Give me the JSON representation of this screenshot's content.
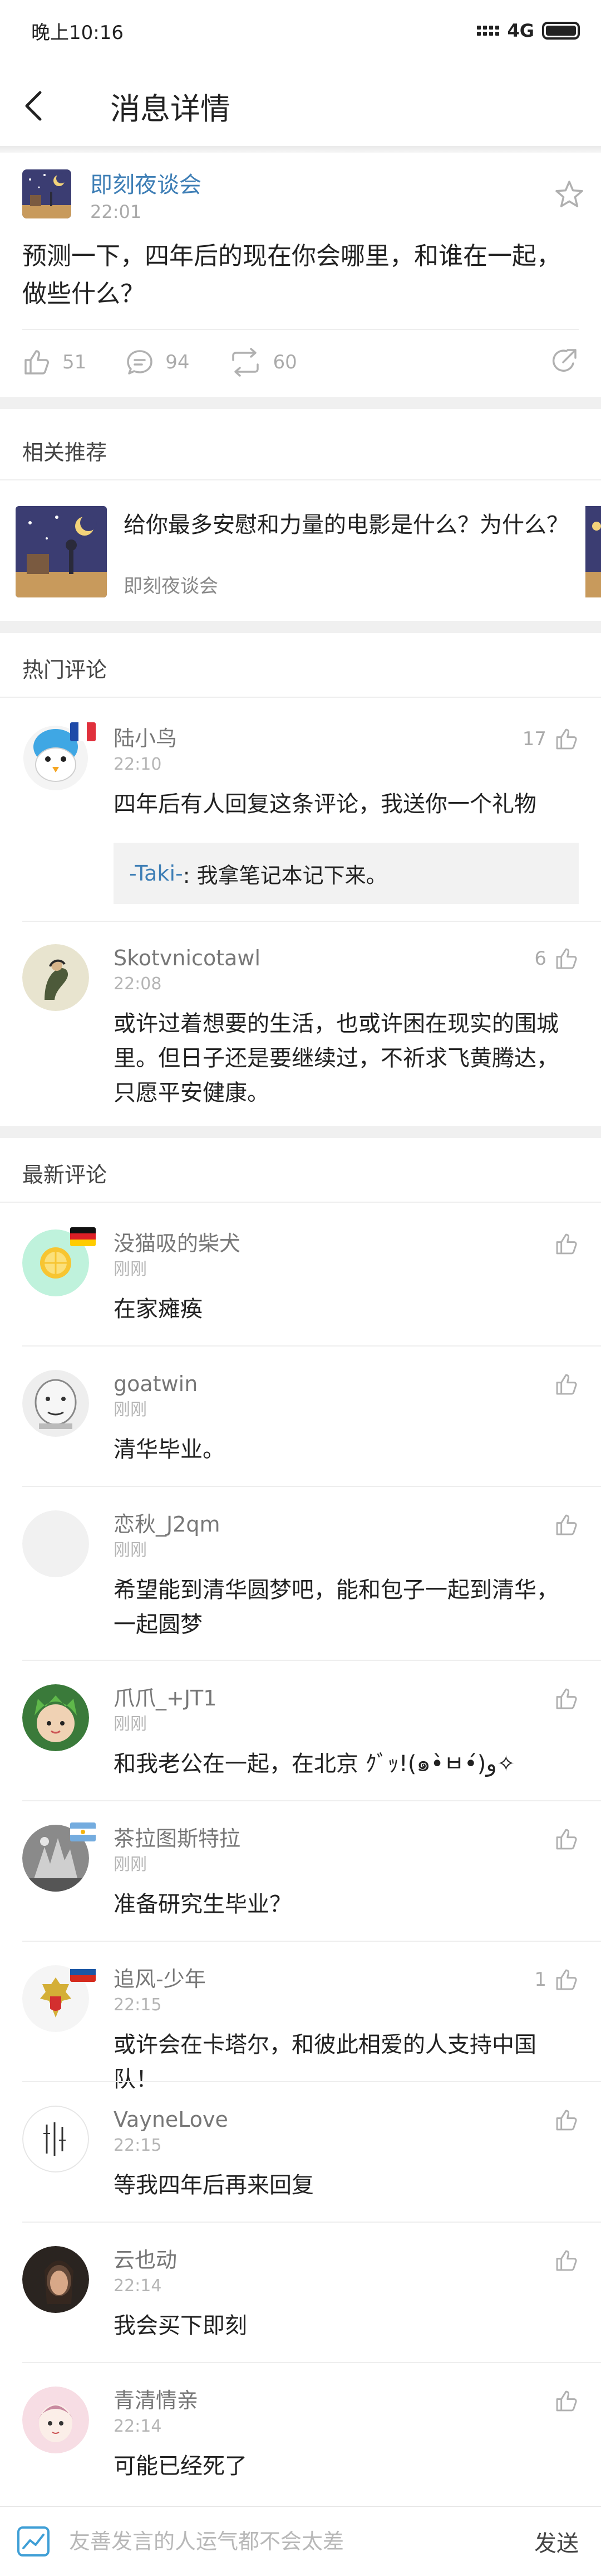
{
  "status_bar": {
    "time": "晚上10:16",
    "network": "4G"
  },
  "header": {
    "title": "消息详情"
  },
  "post": {
    "group_name": "即刻夜谈会",
    "time": "22:01",
    "text": "预测一下，四年后的现在你会哪里，和谁在一起，做些什么？",
    "likes": "51",
    "comments": "94",
    "reposts": "60"
  },
  "related": {
    "heading": "相关推荐",
    "items": [
      {
        "title": "给你最多安慰和力量的电影是什么？为什么？",
        "group": "即刻夜谈会"
      }
    ]
  },
  "hot": {
    "heading": "热门评论",
    "comments": [
      {
        "name": "陆小鸟",
        "time": "22:10",
        "likes": "17",
        "text": "四年后有人回复这条评论，我送你一个礼物",
        "flag": "france",
        "reply_user": "-Taki-",
        "reply_text": ": 我拿笔记本记下来。"
      },
      {
        "name": "Skotvnicotawl",
        "time": "22:08",
        "likes": "6",
        "text": "或许过着想要的生活，也或许困在现实的围城里。但日子还是要继续过，不祈求飞黄腾达，只愿平安健康。"
      }
    ]
  },
  "latest": {
    "heading": "最新评论",
    "comments": [
      {
        "name": "没猫吸的柴犬",
        "time": "刚刚",
        "likes": "",
        "text": "在家瘫痪",
        "flag": "germany"
      },
      {
        "name": "goatwin",
        "time": "刚刚",
        "likes": "",
        "text": "清华毕业。"
      },
      {
        "name": "恋秋_J2qm",
        "time": "刚刚",
        "likes": "",
        "text": "希望能到清华圆梦吧，能和包子一起到清华，一起圆梦"
      },
      {
        "name": "爪爪_+JT1",
        "time": "刚刚",
        "likes": "",
        "text": "和我老公在一起，在北京 ｸﾞｯ!(๑•̀ㅂ•́)و✧"
      },
      {
        "name": "茶拉图斯特拉",
        "time": "刚刚",
        "likes": "",
        "text": "准备研究生毕业？",
        "flag": "argentina"
      },
      {
        "name": "追风-少年",
        "time": "22:15",
        "likes": "1",
        "text": "或许会在卡塔尔，和彼此相爱的人支持中国队！",
        "flag": "russia"
      },
      {
        "name": "VayneLove",
        "time": "22:15",
        "likes": "",
        "text": "等我四年后再来回复"
      },
      {
        "name": "云也动",
        "time": "22:14",
        "likes": "",
        "text": "我会买下即刻"
      },
      {
        "name": "青清情亲",
        "time": "22:14",
        "likes": "",
        "text": "可能已经死了"
      }
    ]
  },
  "compose": {
    "placeholder": "友善发言的人运气都不会太差",
    "send_label": "发送"
  },
  "colors": {
    "link_blue": "#3f7fb6",
    "muted_gray": "#aaaaaa",
    "section_gap": "#f0f0f0"
  }
}
